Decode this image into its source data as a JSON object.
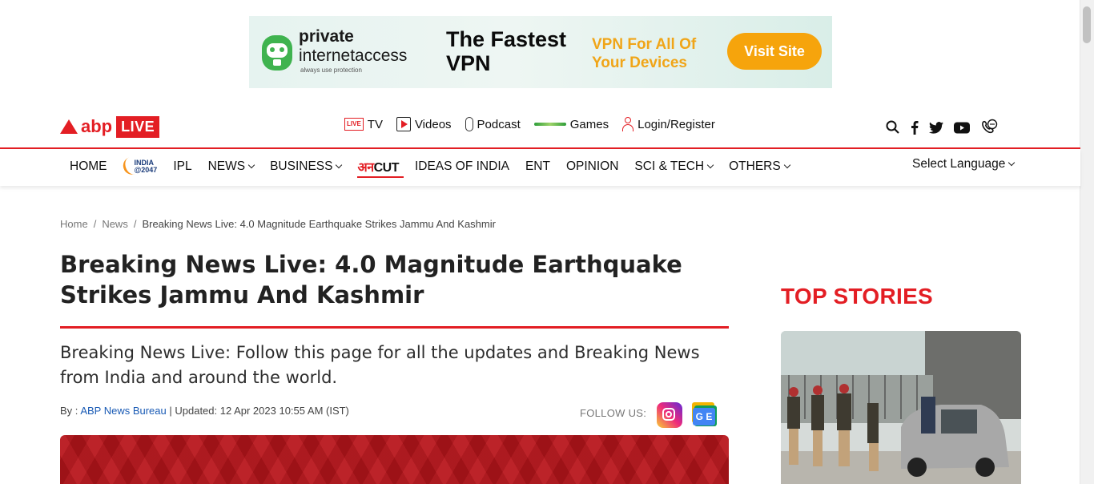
{
  "ad": {
    "brand_line1": "private",
    "brand_line2": "internetaccess",
    "brand_tagline": "always use protection",
    "headline": "The Fastest VPN",
    "subline": "VPN For All Of Your Devices",
    "cta": "Visit Site",
    "colors": {
      "accent": "#f6a40c",
      "logo_green": "#3fb34f"
    }
  },
  "header": {
    "logo_abp": "abp",
    "logo_live": "LIVE",
    "top_links": [
      {
        "icon": "tv-live-icon",
        "tv_badge": "LIVE",
        "label": "TV"
      },
      {
        "icon": "play-icon",
        "label": "Videos"
      },
      {
        "icon": "microphone-icon",
        "label": "Podcast"
      },
      {
        "icon": "games-icon",
        "label": "Games"
      },
      {
        "icon": "user-icon",
        "label": "Login/Register"
      }
    ],
    "social_icons": [
      "search-icon",
      "facebook-icon",
      "twitter-icon",
      "youtube-icon",
      "whatsapp-call-icon"
    ]
  },
  "nav": {
    "items": [
      {
        "label": "HOME",
        "dropdown": false
      },
      {
        "label": "INDIA",
        "sub": "@2047",
        "logo": true
      },
      {
        "label": "IPL",
        "dropdown": false
      },
      {
        "label": "NEWS",
        "dropdown": true
      },
      {
        "label": "BUSINESS",
        "dropdown": true
      },
      {
        "label_hi": "अन",
        "label_cut": "CUT",
        "logo": true
      },
      {
        "label": "IDEAS OF INDIA",
        "dropdown": false
      },
      {
        "label": "ENT",
        "dropdown": false
      },
      {
        "label": "OPINION",
        "dropdown": false
      },
      {
        "label": "SCI & TECH",
        "dropdown": true
      },
      {
        "label": "OTHERS",
        "dropdown": true
      }
    ],
    "language": "Select Language"
  },
  "breadcrumb": [
    "Home",
    "News",
    "Breaking News Live: 4.0 Magnitude Earthquake Strikes Jammu And Kashmir"
  ],
  "article": {
    "title": "Breaking News Live: 4.0 Magnitude Earthquake Strikes Jammu And Kashmir",
    "summary": "Breaking News Live: Follow this page for all the updates and Breaking News from India and around the world.",
    "by_prefix": "By :",
    "author": "ABP News Bureau",
    "updated": "| Updated: 12 Apr 2023 10:55 AM (IST)",
    "follow_label": "FOLLOW US:",
    "google_news_badge": "G E"
  },
  "sidebar": {
    "heading": "TOP STORIES"
  },
  "colors": {
    "brand_red": "#e31e24",
    "link_blue": "#1a5bb5"
  }
}
